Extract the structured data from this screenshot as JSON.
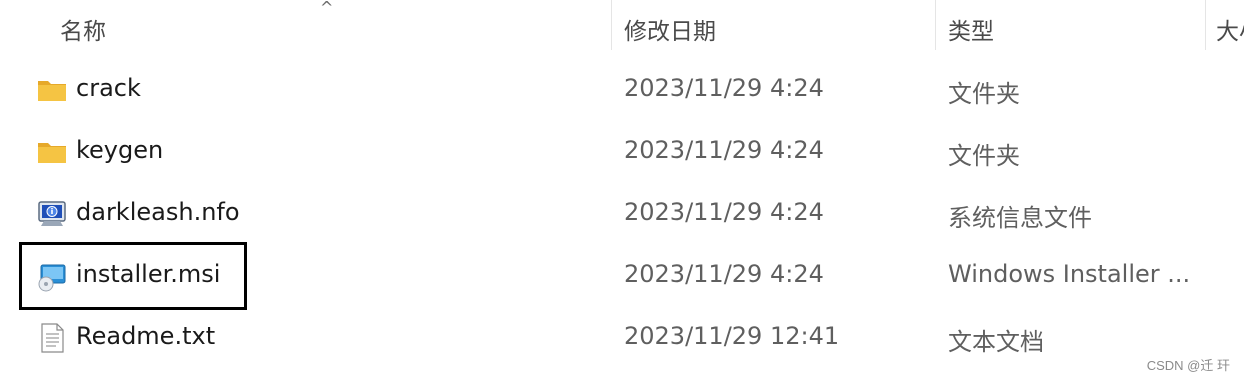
{
  "columns": {
    "name": "名称",
    "modified": "修改日期",
    "type": "类型",
    "size": "大小"
  },
  "files": [
    {
      "name": "crack",
      "modified": "2023/11/29 4:24",
      "type": "文件夹",
      "icon": "folder-icon"
    },
    {
      "name": "keygen",
      "modified": "2023/11/29 4:24",
      "type": "文件夹",
      "icon": "folder-icon"
    },
    {
      "name": "darkleash.nfo",
      "modified": "2023/11/29 4:24",
      "type": "系统信息文件",
      "icon": "nfo-info-icon"
    },
    {
      "name": "installer.msi",
      "modified": "2023/11/29 4:24",
      "type": "Windows Installer ...",
      "icon": "msi-installer-icon"
    },
    {
      "name": "Readme.txt",
      "modified": "2023/11/29 12:41",
      "type": "文本文档",
      "icon": "text-file-icon"
    }
  ],
  "watermark": "CSDN @迁  玕",
  "colors": {
    "folder": "#f5c443",
    "highlight_border": "#000000"
  }
}
